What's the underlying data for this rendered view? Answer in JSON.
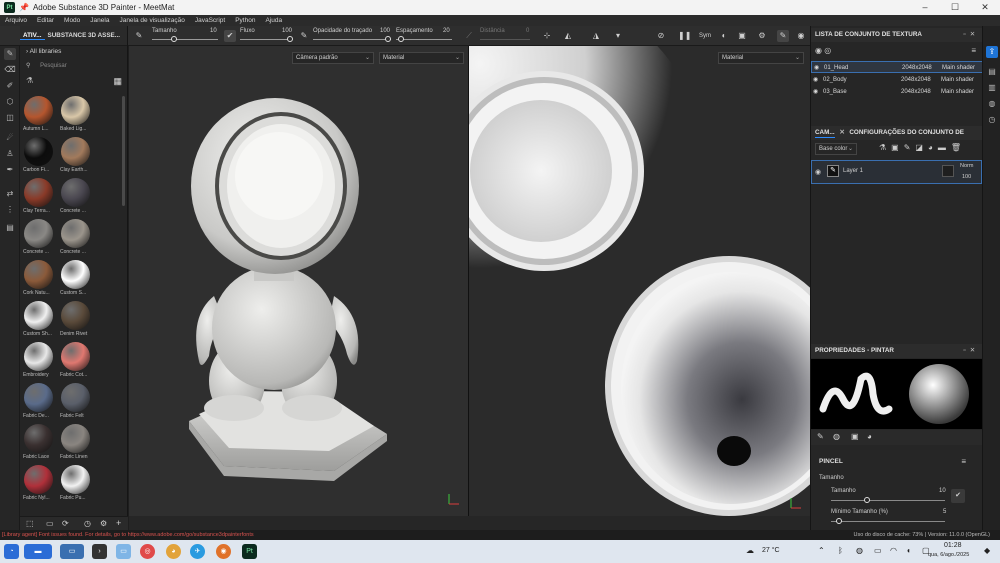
{
  "window": {
    "title": "Adobe Substance 3D Painter - MeetMat",
    "app_icon_text": "Pt",
    "controls": [
      "–",
      "☐",
      "✕"
    ]
  },
  "menu": [
    "Arquivo",
    "Editar",
    "Modo",
    "Janela",
    "Janela de visualização",
    "JavaScript",
    "Python",
    "Ajuda"
  ],
  "toolbar": {
    "size_label": "Tamanho",
    "size_value": "10",
    "flow_label": "Fluxo",
    "flow_value": "100",
    "stroke_opacity_label": "Opacidade do traçado",
    "stroke_opacity_value": "100",
    "spacing_label": "Espaçamento",
    "spacing_value": "20",
    "distance_label": "Distância",
    "distance_value": "0",
    "sym_label": "Sym"
  },
  "assets": {
    "tabs": [
      "ATIV...",
      "SUBSTANCE 3D ASSE..."
    ],
    "libraries_label": "All libraries",
    "search_placeholder": "Pesquisar",
    "items": [
      {
        "label": "Autumn L...",
        "color": "#b5562e"
      },
      {
        "label": "Baked Lig...",
        "color": "#d9c7a8"
      },
      {
        "label": "Carbon Fi...",
        "color": "#0c0c0c"
      },
      {
        "label": "Clay Earth...",
        "color": "#a27a5c"
      },
      {
        "label": "Clay Terra...",
        "color": "#8a3a28"
      },
      {
        "label": "Concrete ...",
        "color": "#4a4750"
      },
      {
        "label": "Concrete ...",
        "color": "#8a8885"
      },
      {
        "label": "Concrete ...",
        "color": "#9b958c"
      },
      {
        "label": "Cork Natu...",
        "color": "#8b5a3a"
      },
      {
        "label": "Custom S...",
        "color": "#ffffff"
      },
      {
        "label": "Custom Sh...",
        "color": "#f0f0f0"
      },
      {
        "label": "Denim Rivet",
        "color": "#5a4a3a"
      },
      {
        "label": "Embroidery",
        "color": "#e8e8e8"
      },
      {
        "label": "Fabric Cot...",
        "color": "#e07870"
      },
      {
        "label": "Fabric De...",
        "color": "#5a6b8a"
      },
      {
        "label": "Fabric Felt",
        "color": "#5a5f6a"
      },
      {
        "label": "Fabric Lace",
        "color": "#3a3030"
      },
      {
        "label": "Fabric Linen",
        "color": "#8a8580"
      },
      {
        "label": "Fabric Nyl...",
        "color": "#b0303a"
      },
      {
        "label": "Fabric Pu...",
        "color": "#f2f2f2"
      }
    ]
  },
  "viewport3d": {
    "camera_select": "Câmera padrão",
    "mode_select": "Material"
  },
  "viewport2d": {
    "mode_select": "Material"
  },
  "texture_sets": {
    "title": "LISTA DE CONJUNTO DE TEXTURA",
    "rows": [
      {
        "name": "01_Head",
        "size": "2048x2048",
        "shader": "Main shader"
      },
      {
        "name": "02_Body",
        "size": "2048x2048",
        "shader": "Main shader"
      },
      {
        "name": "03_Base",
        "size": "2048x2048",
        "shader": "Main shader"
      }
    ]
  },
  "layers": {
    "tab_layers": "CAM...",
    "tab_settings": "CONFIGURAÇÕES DO CONJUNTO DE TEXTU...",
    "channel_select": "Base color",
    "layer_name": "Layer 1",
    "blend_mode": "Norm",
    "opacity": "100"
  },
  "properties": {
    "title": "PROPRIEDADES - PINTAR",
    "section": "PINCEL",
    "size_group": "Tamanho",
    "size_label": "Tamanho",
    "size_value": "10",
    "min_size_label": "Mínimo Tamanho (%)",
    "min_size_value": "5"
  },
  "status": {
    "error": "[Library agent] Font issues found. For details, go to https://www.adobe.com/go/substance3dpainterfonts",
    "info": "Uso do disco de cache:  73% | Version: 11.0.0 (OpenGL)"
  },
  "taskbar": {
    "temperature": "27 °C",
    "time": "01:28",
    "date": "qua, 6/ago./2025"
  },
  "colors": {
    "accent": "#2b8bff",
    "error": "#d9534f",
    "panel_bg": "#262626"
  }
}
